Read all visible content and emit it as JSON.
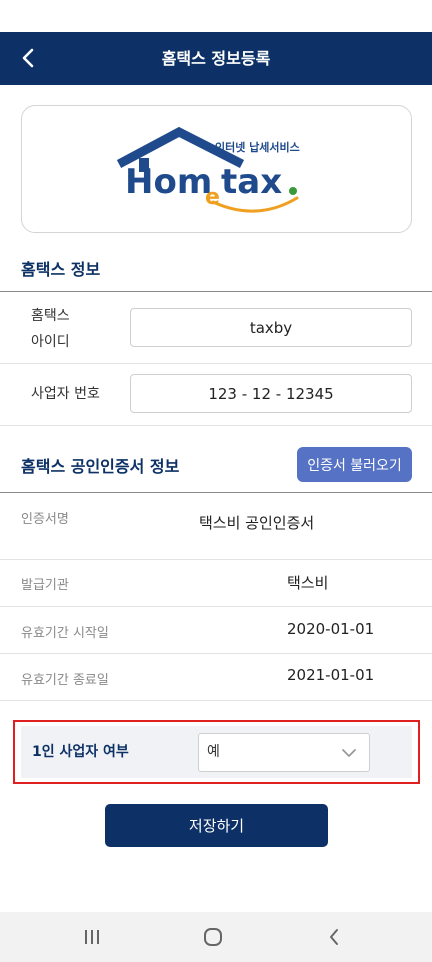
{
  "header": {
    "title": "홈택스 정보등록"
  },
  "logo": {
    "brand_text": "Hometax",
    "tagline": "인터넷 납세서비스"
  },
  "hometax_info": {
    "section_title": "홈택스 정보",
    "id_label_line1": "홈택스",
    "id_label_line2": "아이디",
    "id_value": "taxby",
    "business_no_label": "사업자 번호",
    "business_no_value": "123 - 12 - 12345"
  },
  "certificate": {
    "section_title": "홈택스 공인인증서 정보",
    "load_button": "인증서 불러오기",
    "rows": [
      {
        "label": "인증서명",
        "value": "택스비 공인인증서"
      },
      {
        "label": "발급기관",
        "value": "택스비"
      },
      {
        "label": "유효기간 시작일",
        "value": "2020-01-01"
      },
      {
        "label": "유효기간 종료일",
        "value": "2021-01-01"
      }
    ]
  },
  "sole_proprietor": {
    "label": "1인 사업자 여부",
    "selected": "예"
  },
  "actions": {
    "save": "저장하기"
  },
  "colors": {
    "primary": "#0d3166",
    "button_blue": "#5572c4",
    "highlight_red": "#e02020",
    "logo_navy": "#1f4a8c",
    "logo_orange": "#f0a020",
    "logo_green": "#3a9a3a"
  },
  "icons": {
    "back": "chevron-left-icon",
    "dropdown": "chevron-down-icon",
    "nav_recent": "recent-apps-icon",
    "nav_home": "home-icon",
    "nav_back": "back-icon"
  }
}
